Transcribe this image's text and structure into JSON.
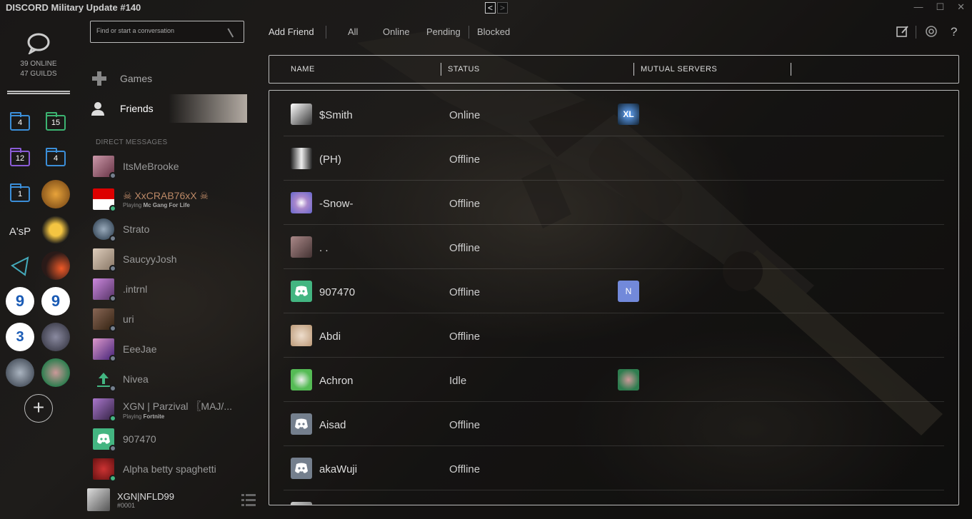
{
  "window": {
    "title": "DISCORD Military Update #140",
    "back_arrow": "<",
    "forward_arrow": ">",
    "controls": [
      "—",
      "☐",
      "✕"
    ]
  },
  "guilds": {
    "online_count": "39 ONLINE",
    "guild_count": "47 GUILDS",
    "folders": [
      {
        "count": "4",
        "color": "#3b8ed8"
      },
      {
        "count": "15",
        "color": "#3cb371"
      },
      {
        "count": "12",
        "color": "#8a5cd6"
      },
      {
        "count": "4",
        "color": "#3b8ed8"
      },
      {
        "count": "1",
        "color": "#3b8ed8"
      }
    ],
    "text_server": "A'sP",
    "add_label": "+"
  },
  "dm": {
    "search_placeholder": "Find or start a conversation",
    "nav": {
      "games": "Games",
      "friends": "Friends"
    },
    "heading": "DIRECT MESSAGES",
    "items": [
      {
        "name": "ItsMeBrooke",
        "sub": "",
        "status": "offline"
      },
      {
        "name": "☠ XxCRAB76xX ☠",
        "sub": "Playing",
        "game": "Mc Gang For Life",
        "status": "online"
      },
      {
        "name": "Strato",
        "sub": "",
        "status": "offline"
      },
      {
        "name": "SaucyyJosh",
        "sub": "",
        "status": "offline"
      },
      {
        "name": ".intrnl",
        "sub": "",
        "status": "offline"
      },
      {
        "name": "uri",
        "sub": "",
        "status": "offline"
      },
      {
        "name": "EeeJae",
        "sub": "",
        "status": "offline"
      },
      {
        "name": "Nivea",
        "sub": "",
        "status": "offline"
      },
      {
        "name": "XGN | Parzival 〖MAJ/...",
        "sub": "Playing",
        "game": "Fortnite",
        "status": "online"
      },
      {
        "name": "907470",
        "sub": "",
        "status": "offline"
      },
      {
        "name": "Alpha betty spaghetti",
        "sub": "",
        "status": "online"
      }
    ],
    "user": {
      "name": "XGN|NFLD99",
      "discriminator": "#0001"
    }
  },
  "topbar": {
    "add_friend": "Add Friend",
    "tabs": [
      "All",
      "Online",
      "Pending",
      "Blocked"
    ]
  },
  "table": {
    "headers": {
      "name": "NAME",
      "status": "STATUS",
      "mutual": "MUTUAL SERVERS"
    },
    "rows": [
      {
        "name": "$Smith",
        "status": "Online",
        "mutual": "XL"
      },
      {
        "name": "(PH)",
        "status": "Offline",
        "mutual": ""
      },
      {
        "name": "-Snow-",
        "status": "Offline",
        "mutual": ""
      },
      {
        "name": ". .",
        "status": "Offline",
        "mutual": ""
      },
      {
        "name": "907470",
        "status": "Offline",
        "mutual": "N"
      },
      {
        "name": "Abdi",
        "status": "Offline",
        "mutual": ""
      },
      {
        "name": "Achron",
        "status": "Idle",
        "mutual": "avatar"
      },
      {
        "name": "Aisad",
        "status": "Offline",
        "mutual": ""
      },
      {
        "name": "akaWuji",
        "status": "Offline",
        "mutual": ""
      }
    ]
  },
  "colors": {
    "online": "#43b581",
    "offline": "#747f8d",
    "blurple": "#7289da"
  }
}
